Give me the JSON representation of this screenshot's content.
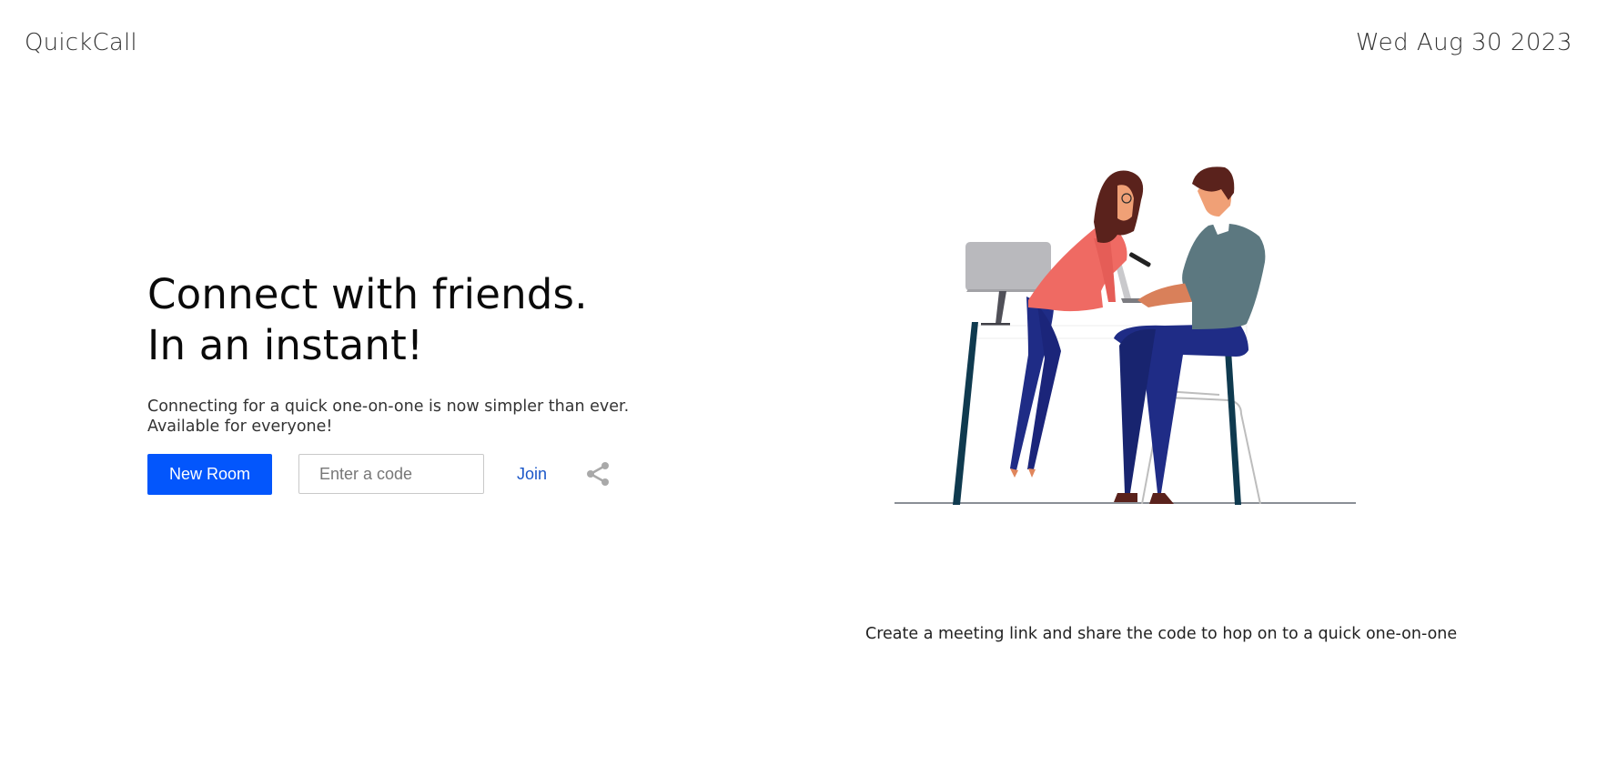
{
  "header": {
    "brand": "QuickCall",
    "date": "Wed Aug 30 2023"
  },
  "hero": {
    "headline_line1": "Connect with friends.",
    "headline_line2": "In an instant!",
    "subtext_line1": "Connecting for a quick one-on-one is now simpler than ever.",
    "subtext_line2": "Available for everyone!"
  },
  "actions": {
    "new_room_label": "New Room",
    "code_placeholder": "Enter a code",
    "code_value": "",
    "join_label": "Join",
    "share_icon": "share-icon"
  },
  "illustration": {
    "icon": "two-people-at-desk-illustration"
  },
  "footer": {
    "caption": "Create a meeting link and share the code to hop on to a quick one-on-one"
  },
  "colors": {
    "primary": "#0356fc",
    "link": "#1b57c8",
    "woman_top": "#ef6a63",
    "trousers": "#1f2c86",
    "man_shirt": "#5c7880",
    "desk_legs": "#0f3a4f"
  }
}
